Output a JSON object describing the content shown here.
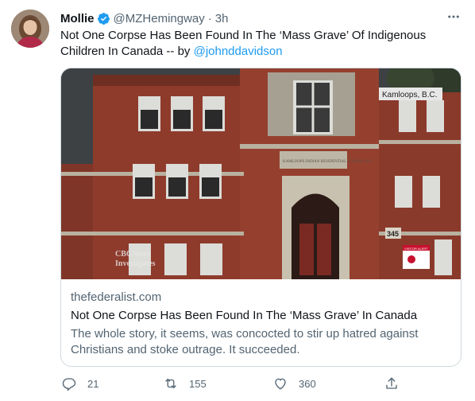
{
  "author": {
    "name": "Mollie",
    "handle": "@MZHemingway",
    "separator": "·",
    "time": "3h",
    "verified": true
  },
  "tweet": {
    "text": "Not One Corpse Has Been Found In The ‘Mass Grave’ Of Indigenous Children In Canada -- by ",
    "mention": "@johnddavidson"
  },
  "card": {
    "image": {
      "location_label": "Kamloops, B.C.",
      "watermark_line1": "CBCNews",
      "watermark_line2": "Investigates",
      "building_number": "345",
      "sign_text": "VISITOR ALERT",
      "engraving": "KAMLOOPS INDIAN RESIDENTIAL SCHOOL 1923"
    },
    "domain": "thefederalist.com",
    "title": "Not One Corpse Has Been Found In The ‘Mass Grave’ In Canada",
    "description": "The whole story, it seems, was concocted to stir up hatred against Christians and stoke outrage. It succeeded."
  },
  "actions": {
    "replies": "21",
    "retweets": "155",
    "likes": "360"
  },
  "colors": {
    "accent": "#1d9bf0",
    "text_primary": "#0f1419",
    "text_secondary": "#536471",
    "border": "#cfd9de",
    "brick": "#8e3b2c"
  },
  "icons": [
    "verified-badge-icon",
    "more-options-icon",
    "reply-icon",
    "retweet-icon",
    "like-icon",
    "share-icon"
  ]
}
